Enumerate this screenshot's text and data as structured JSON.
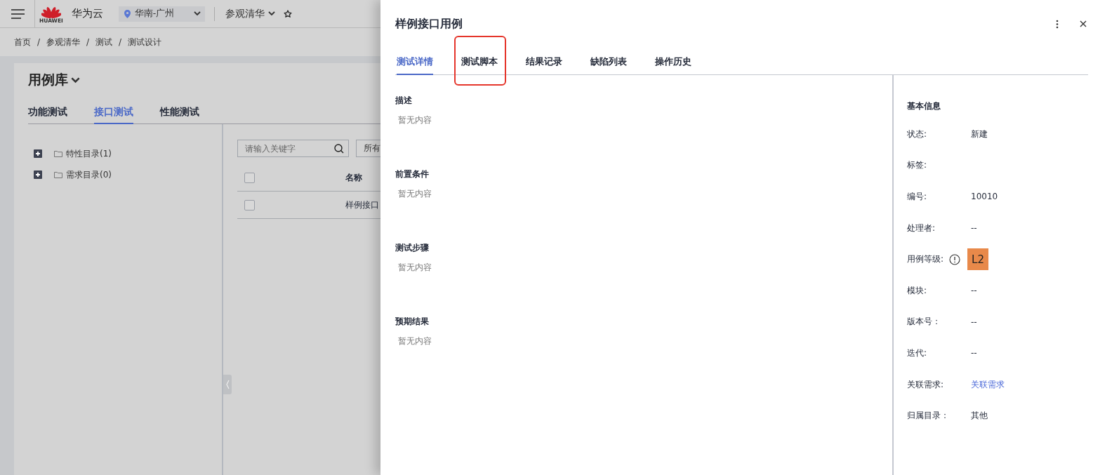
{
  "header": {
    "logo_text": "HUAWEI",
    "brand": "华为云",
    "region": "华南-广州",
    "project": "参观清华"
  },
  "breadcrumb": {
    "separator": "/",
    "items": [
      "首页",
      "参观清华",
      "测试",
      "测试设计"
    ]
  },
  "library": {
    "title": "用例库",
    "tabs": [
      {
        "label": "功能测试",
        "selected": false
      },
      {
        "label": "接口测试",
        "selected": true
      },
      {
        "label": "性能测试",
        "selected": false
      }
    ],
    "tree": [
      {
        "label": "特性目录(1)",
        "expanded": false
      },
      {
        "label": "需求目录(0)",
        "expanded": false
      }
    ],
    "search": {
      "placeholder": "请输入关键字"
    },
    "filter": "所有",
    "table": {
      "header_checked": false,
      "columns": [
        "名称"
      ],
      "rows": [
        {
          "name": "样例接口",
          "checked": false
        }
      ]
    }
  },
  "drawer": {
    "title": "样例接口用例",
    "tabs": [
      {
        "label": "测试详情",
        "selected": true,
        "highlighted": false
      },
      {
        "label": "测试脚本",
        "selected": false,
        "highlighted": true
      },
      {
        "label": "结果记录",
        "selected": false,
        "highlighted": false
      },
      {
        "label": "缺陷列表",
        "selected": false,
        "highlighted": false
      },
      {
        "label": "操作历史",
        "selected": false,
        "highlighted": false
      }
    ],
    "sections": [
      {
        "heading": "描述",
        "content": "暂无内容"
      },
      {
        "heading": "前置条件",
        "content": "暂无内容"
      },
      {
        "heading": "测试步骤",
        "content": "暂无内容"
      },
      {
        "heading": "预期结果",
        "content": "暂无内容"
      }
    ],
    "info": {
      "title": "基本信息",
      "rows": [
        {
          "label": "状态:",
          "kind": "text",
          "value": "新建"
        },
        {
          "label": "标签:",
          "kind": "text"
        },
        {
          "label": "编号:",
          "kind": "text",
          "value": "10010"
        },
        {
          "label": "处理者:",
          "kind": "text",
          "value": "--"
        },
        {
          "label": "用例等级:",
          "kind": "level",
          "value": "L2",
          "color": "#e8894a"
        },
        {
          "label": "模块:",
          "kind": "text",
          "value": "--"
        },
        {
          "label": "版本号：",
          "kind": "text",
          "value": "--"
        },
        {
          "label": "迭代:",
          "kind": "text",
          "value": "--"
        },
        {
          "label": "关联需求:",
          "kind": "link",
          "value": "关联需求"
        },
        {
          "label": "归属目录：",
          "kind": "text",
          "value": "其他"
        }
      ]
    }
  }
}
